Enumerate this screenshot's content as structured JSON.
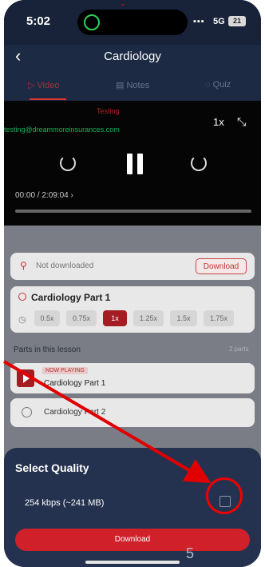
{
  "status_bar": {
    "time": "5:02",
    "network": "5G",
    "battery": "21"
  },
  "header": {
    "title": "Cardiology"
  },
  "tabs": [
    {
      "label": "Video",
      "active": true
    },
    {
      "label": "Notes",
      "active": false
    },
    {
      "label": "Quiz",
      "active": false
    }
  ],
  "video": {
    "overlay_label": "Testing",
    "overlay_email": "testing@dreammoreinsurances.com",
    "speed": "1x",
    "time": "00:00 / 2:09:04",
    "progress": 0
  },
  "download_card": {
    "status": "Not downloaded",
    "button": "Download"
  },
  "part_card": {
    "title": "Cardiology Part 1",
    "speeds": [
      "0.5x",
      "0.75x",
      "1x",
      "1.25x",
      "1.5x",
      "1.75x"
    ],
    "selected_speed": "1x"
  },
  "parts": {
    "heading": "Parts in this lesson",
    "count": "2 parts",
    "items": [
      {
        "tag": "NOW PLAYING",
        "title": "Cardiology Part 1"
      },
      {
        "title": "Cardiology Part 2"
      }
    ]
  },
  "sheet": {
    "title": "Select Quality",
    "option": "254 kbps (~241 MB)",
    "button": "Download",
    "page_number": "5"
  },
  "colors": {
    "accent": "#d0202a",
    "background": "#1d2a44",
    "annotation": "#e00000"
  },
  "icons": [
    "back-chevron-icon",
    "fullscreen-icon",
    "rewind-icon",
    "pause-icon",
    "forward-icon",
    "download-status-icon",
    "speed-icon",
    "play-icon"
  ]
}
